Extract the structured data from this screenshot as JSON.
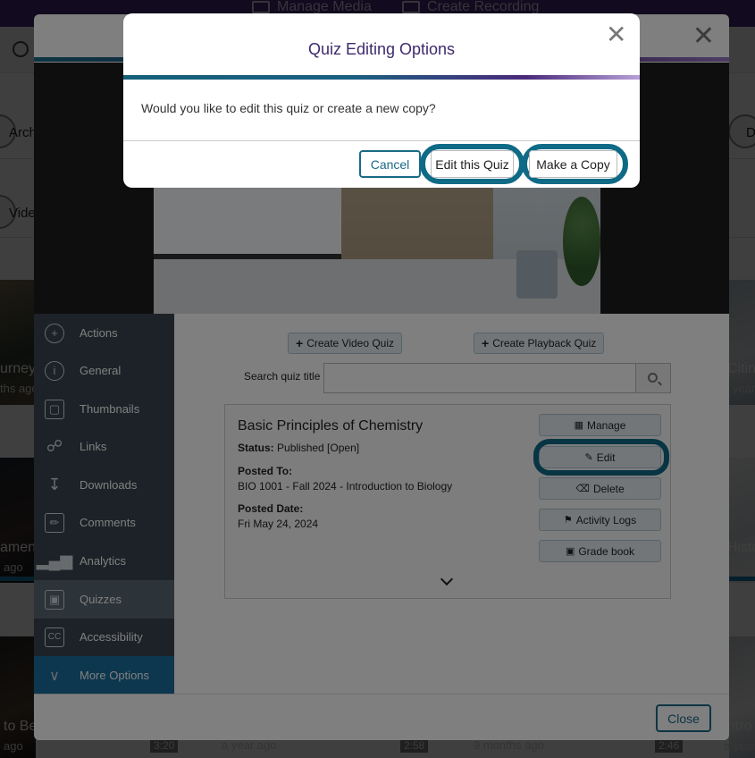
{
  "topbar": {
    "manage_media": "Manage Media",
    "create_recording": "Create Recording"
  },
  "background": {
    "rows": [
      "Arch",
      "Vide",
      "De"
    ],
    "thumbs": [
      {
        "label": "urney",
        "sub": "ths ago"
      },
      {
        "label": "amen",
        "sub": "ago"
      },
      {
        "label": "to Be",
        "sub": "ago"
      },
      {
        "label": "Citing",
        "sub": "year"
      },
      {
        "label": "Histo",
        "sub": "mon"
      },
      {
        "label": "ntro",
        "sub": "a year"
      }
    ],
    "footer_items": [
      {
        "text": "a year ago",
        "dur": "2:58"
      },
      {
        "text": "9 months ago",
        "dur": "2:46"
      },
      {
        "text": "",
        "dur": "3:20"
      }
    ]
  },
  "sidebar": {
    "items": [
      {
        "label": "Actions",
        "icon": "plus-circle-icon"
      },
      {
        "label": "General",
        "icon": "info-icon"
      },
      {
        "label": "Thumbnails",
        "icon": "thumbnails-icon"
      },
      {
        "label": "Links",
        "icon": "link-icon"
      },
      {
        "label": "Downloads",
        "icon": "download-icon"
      },
      {
        "label": "Comments",
        "icon": "comments-icon"
      },
      {
        "label": "Analytics",
        "icon": "analytics-icon"
      },
      {
        "label": "Quizzes",
        "icon": "quiz-icon"
      },
      {
        "label": "Accessibility",
        "icon": "cc-icon"
      },
      {
        "label": "More Options",
        "icon": "chevron-down-icon"
      }
    ]
  },
  "quiz_panel": {
    "create_video_quiz": "Create Video Quiz",
    "create_playback_quiz": "Create Playback Quiz",
    "search_label": "Search quiz title",
    "search_value": "",
    "card": {
      "title": "Basic Principles of Chemistry",
      "status_label": "Status:",
      "status_value": "Published [Open]",
      "posted_to_label": "Posted To:",
      "posted_to_value": "BIO 1001 - Fall 2024 - Introduction to Biology",
      "posted_date_label": "Posted Date:",
      "posted_date_value": "Fri May 24, 2024",
      "buttons": {
        "manage": "Manage",
        "edit": "Edit",
        "delete": "Delete",
        "activity_logs": "Activity Logs",
        "grade_book": "Grade book"
      }
    }
  },
  "modal_footer": {
    "close": "Close"
  },
  "dialog": {
    "title": "Quiz Editing Options",
    "message": "Would you like to edit this quiz or create a new copy?",
    "cancel": "Cancel",
    "edit": "Edit this Quiz",
    "copy": "Make a Copy"
  },
  "colors": {
    "accent_teal": "#0e6a86",
    "brand_purple": "#4a2a7a",
    "sidebar_bg": "#38444f",
    "sidebar_active": "#586672",
    "more_options_bg": "#1a6e9e"
  }
}
